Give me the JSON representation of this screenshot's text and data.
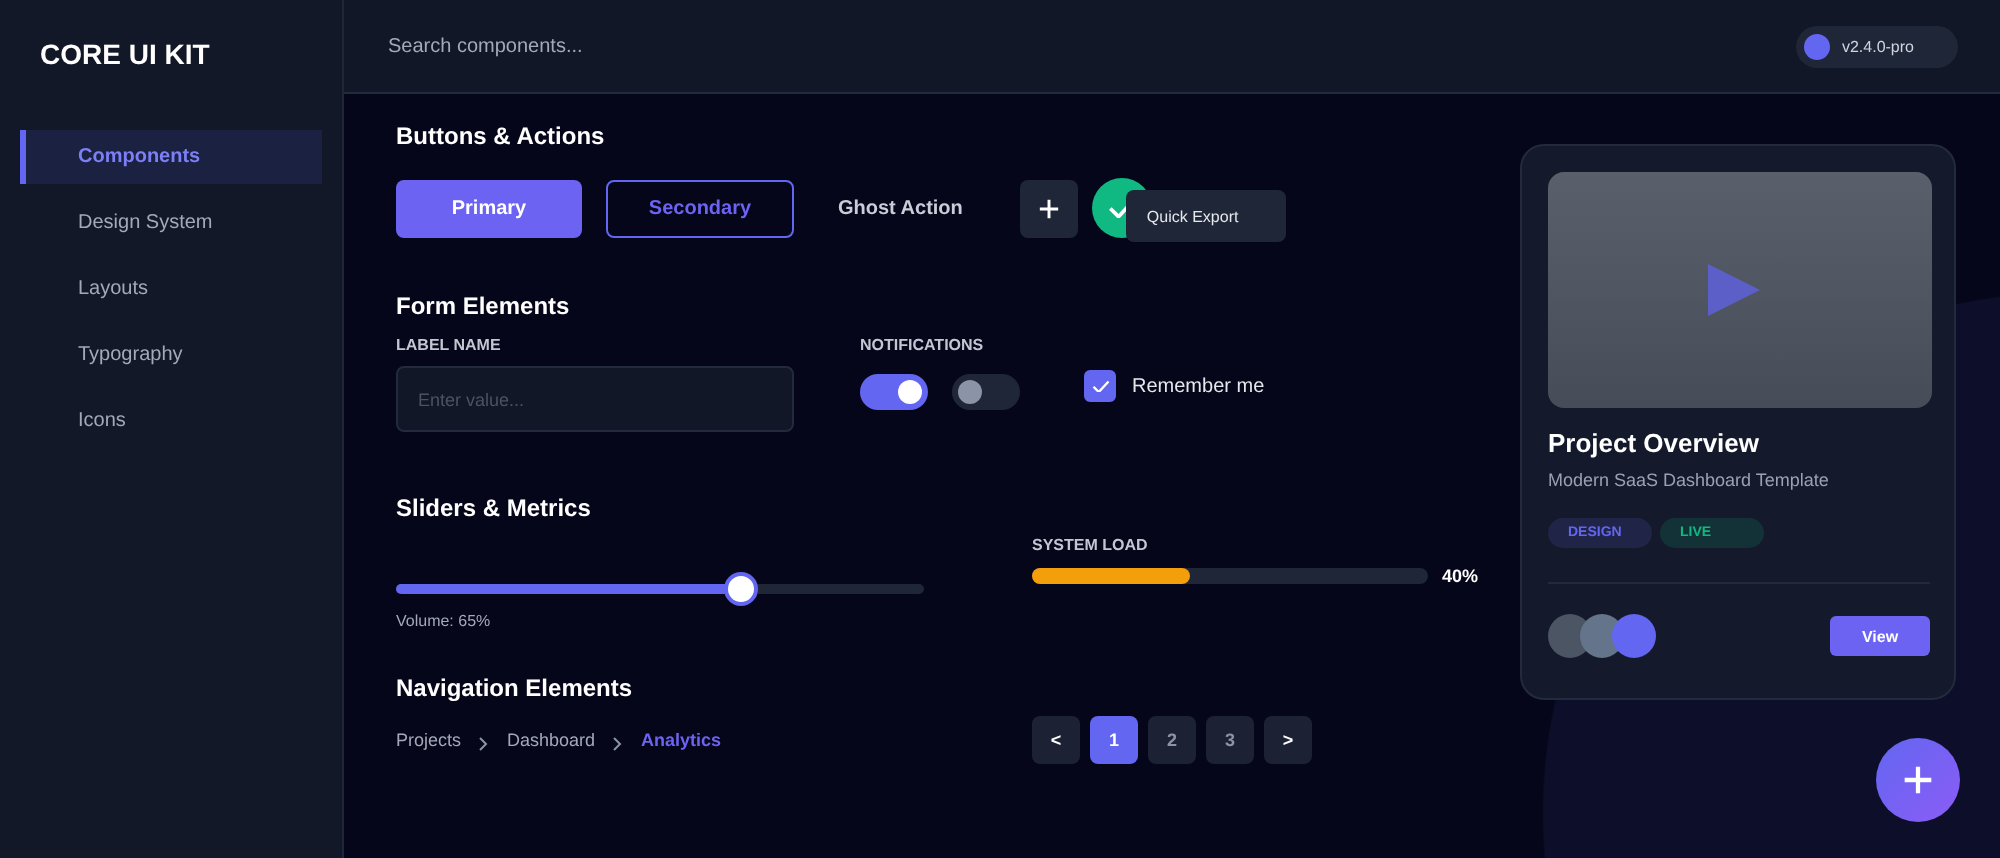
{
  "sidebar": {
    "logo": "CORE UI KIT",
    "items": [
      {
        "label": "Components",
        "selected": true
      },
      {
        "label": "Design System",
        "selected": false
      },
      {
        "label": "Layouts",
        "selected": false
      },
      {
        "label": "Typography",
        "selected": false
      },
      {
        "label": "Icons",
        "selected": false
      }
    ]
  },
  "header": {
    "search": {
      "placeholder": "Search components..."
    },
    "version": "v2.4.0-pro"
  },
  "buttons_section": {
    "title": "Buttons & Actions",
    "buttons": [
      {
        "kind": "primary",
        "label": "Primary"
      },
      {
        "kind": "secondary",
        "label": "Secondary"
      },
      {
        "kind": "ghost",
        "label": "Ghost Action"
      },
      {
        "kind": "add"
      },
      {
        "kind": "success"
      }
    ],
    "tooltip": "Quick Export"
  },
  "form": {
    "title": "Form Elements",
    "field": {
      "label": "LABEL NAME",
      "placeholder": "Enter value..."
    },
    "notifications": {
      "label": "NOTIFICATIONS",
      "toggles": [
        {
          "on": true
        },
        {
          "on": false
        }
      ]
    },
    "checkbox": {
      "label": "Remember me",
      "checked": true
    }
  },
  "sliders": {
    "title": "Sliders & Metrics",
    "volume": {
      "level": 0.65,
      "caption": "Volume: 65%"
    },
    "system_load": {
      "label": "SYSTEM LOAD",
      "level": 0.4,
      "reading": "40%"
    }
  },
  "navigation": {
    "title": "Navigation Elements",
    "breadcrumb": [
      {
        "label": "Projects",
        "selected": false
      },
      {
        "label": "Dashboard",
        "selected": false
      },
      {
        "label": "Analytics",
        "selected": true
      }
    ],
    "pagination": {
      "prev": "<",
      "next": ">",
      "pages": [
        {
          "label": "1",
          "selected": true
        },
        {
          "label": "2",
          "selected": false
        },
        {
          "label": "3",
          "selected": false
        }
      ]
    }
  },
  "card": {
    "title": "Project Overview",
    "subtitle": "Modern SaaS Dashboard Template",
    "tags": [
      {
        "label": "DESIGN",
        "color": "#6366f1"
      },
      {
        "label": "LIVE",
        "color": "#10b981"
      }
    ],
    "avatars": [
      {
        "color": "#4b5563"
      },
      {
        "color": "#64748b"
      },
      {
        "color": "#6366f1"
      }
    ],
    "action": "View"
  }
}
